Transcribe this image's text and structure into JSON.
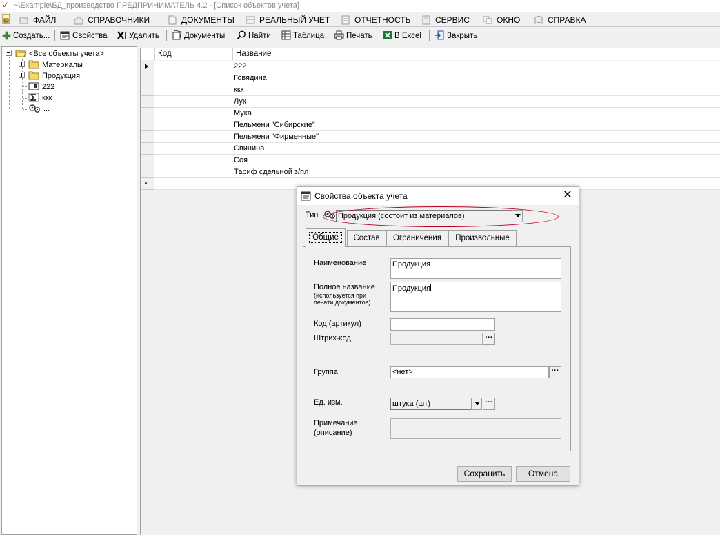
{
  "window": {
    "title": "~\\Example\\БД_производство  ПРЕДПРИНИМАТЕЛЬ 4.2 - [Список объектов учета]"
  },
  "menu": {
    "items": [
      "ФАЙЛ",
      "СПРАВОЧНИКИ",
      "ДОКУМЕНТЫ",
      "РЕАЛЬНЫЙ УЧЕТ",
      "ОТЧЕТНОСТЬ",
      "СЕРВИС",
      "ОКНО",
      "СПРАВКА"
    ]
  },
  "toolbar": {
    "create": "Создать...",
    "properties": "Свойства",
    "delete": "Удалить",
    "documents": "Документы",
    "find": "Найти",
    "table": "Таблица",
    "print": "Печать",
    "excel": "В Excel",
    "close": "Закрыть"
  },
  "tree": {
    "root": "<Все объекты учета>",
    "items": [
      "Материалы",
      "Продукция",
      "222",
      "ккк",
      "..."
    ]
  },
  "grid": {
    "columns": {
      "code": "Код",
      "name": "Название"
    },
    "rows": [
      "222",
      "Говядина",
      "ккк",
      "Лук",
      "Мука",
      "Пельмени \"Сибирские\"",
      "Пельмени \"Фирменные\"",
      "Свинина",
      "Соя",
      "Тариф сдельной з/пл"
    ],
    "new_row_marker": "*"
  },
  "dialog": {
    "title": "Свойства объекта учета",
    "type_label": "Тип",
    "type_value": "Продукция (состоит из материалов)",
    "tabs": [
      "Общие",
      "Состав",
      "Ограничения",
      "Произвольные"
    ],
    "fields": {
      "name_label": "Наименование",
      "name_value": "Продукция",
      "fullname_label": "Полное название",
      "fullname_hint": "(используется при печати документов)",
      "fullname_value": "Продукция",
      "code_label": "Код (артикул)",
      "code_value": "",
      "barcode_label": "Штрих-код",
      "barcode_value": "",
      "group_label": "Группа",
      "group_value": "<нет>",
      "unit_label": "Ед. изм.",
      "unit_value": "штука (шт)",
      "note_label_1": "Примечание",
      "note_label_2": "(описание)",
      "note_value": ""
    },
    "buttons": {
      "save": "Сохранить",
      "cancel": "Отмена"
    },
    "dots": "···",
    "close_glyph": "✕"
  },
  "colors": {
    "highlight_ellipse": "#c00020",
    "excel_green": "#1e7b34"
  }
}
